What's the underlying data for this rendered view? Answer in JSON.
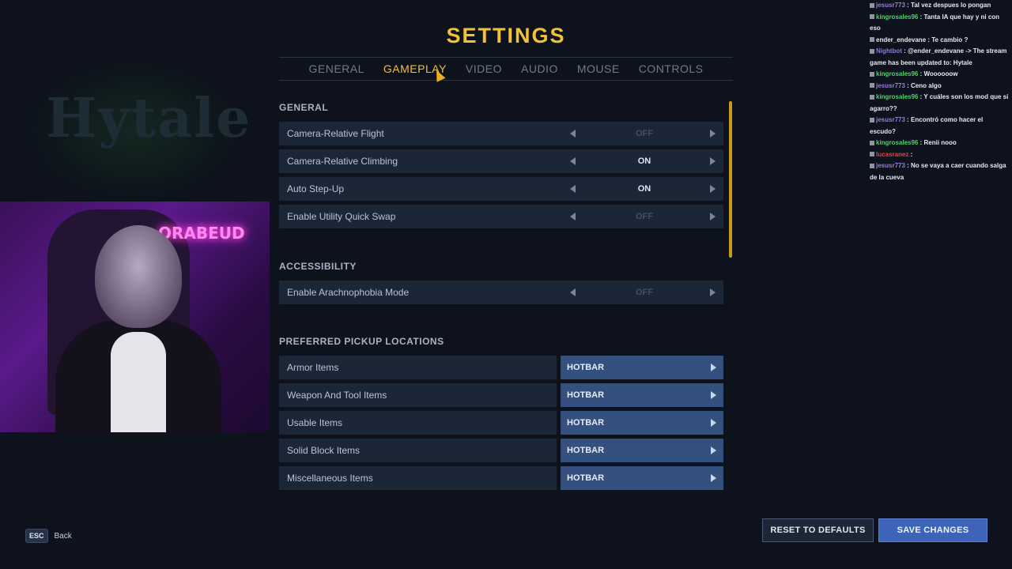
{
  "title": "SETTINGS",
  "tabs": [
    "GENERAL",
    "GAMEPLAY",
    "VIDEO",
    "AUDIO",
    "MOUSE",
    "CONTROLS"
  ],
  "active_tab": "GAMEPLAY",
  "sections": {
    "general": {
      "heading": "GENERAL",
      "rows": [
        {
          "label": "Camera-Relative Flight",
          "value": "OFF"
        },
        {
          "label": "Camera-Relative Climbing",
          "value": "ON"
        },
        {
          "label": "Auto Step-Up",
          "value": "ON"
        },
        {
          "label": "Enable Utility Quick Swap",
          "value": "OFF"
        }
      ]
    },
    "accessibility": {
      "heading": "ACCESSIBILITY",
      "rows": [
        {
          "label": "Enable Arachnophobia Mode",
          "value": "OFF"
        }
      ]
    },
    "pickup": {
      "heading": "PREFERRED PICKUP LOCATIONS",
      "rows": [
        {
          "label": "Armor Items",
          "value": "HOTBAR"
        },
        {
          "label": "Weapon And Tool Items",
          "value": "HOTBAR"
        },
        {
          "label": "Usable Items",
          "value": "HOTBAR"
        },
        {
          "label": "Solid Block Items",
          "value": "HOTBAR"
        },
        {
          "label": "Miscellaneous Items",
          "value": "HOTBAR"
        }
      ]
    }
  },
  "footer": {
    "esc_key": "ESC",
    "back_label": "Back",
    "reset_label": "RESET TO DEFAULTS",
    "save_label": "SAVE CHANGES"
  },
  "webcam": {
    "neon_text": "ORABEUD"
  },
  "background_logo": "Hytale",
  "chat": [
    {
      "user": "jesusr773",
      "color": "#9a7bd8",
      "text": "Tal vez despues lo pongan"
    },
    {
      "user": "kingrosales96",
      "color": "#4ad46a",
      "text": "Tanta IA que hay y ni con eso"
    },
    {
      "user": "ender_endevane",
      "color": "#e6e9ee",
      "text": "Te cambio ?"
    },
    {
      "user": "Nightbot",
      "color": "#8a7cd8",
      "text": "@ender_endevane -> The stream game has been updated to: Hytale"
    },
    {
      "user": "kingrosales96",
      "color": "#4ad46a",
      "text": "Woooooow"
    },
    {
      "user": "jesusr773",
      "color": "#9a7bd8",
      "text": "Ceno algo"
    },
    {
      "user": "kingrosales96",
      "color": "#4ad46a",
      "text": "Y cuáles son los mod que si agarro??"
    },
    {
      "user": "jesusr773",
      "color": "#9a7bd8",
      "text": "Encontró como hacer el escudo?"
    },
    {
      "user": "kingrosales96",
      "color": "#4ad46a",
      "text": "Renii nooo"
    },
    {
      "user": "lucasranez",
      "color": "#e04545",
      "text": ""
    },
    {
      "user": "jesusr773",
      "color": "#9a7bd8",
      "text": "No se vaya a caer cuando salga de la cueva"
    }
  ],
  "colors": {
    "accent": "#f1c232",
    "background": "#0d121d",
    "row": "#1b2637",
    "pickup_value": "#33507f",
    "save_button": "#3d64b8"
  }
}
